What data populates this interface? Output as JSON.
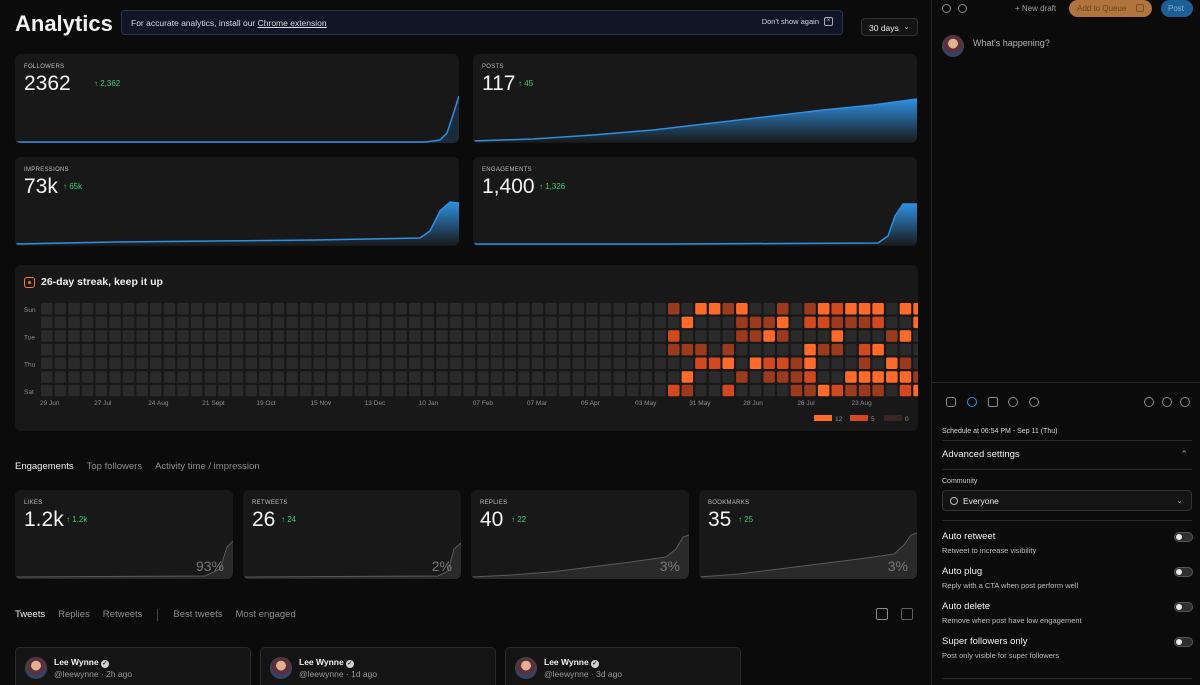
{
  "header": {
    "title": "Analytics",
    "banner_text": "For accurate analytics, install our",
    "banner_link": "Chrome extension",
    "banner_dismiss": "Don't show again",
    "range": "30 days"
  },
  "stats": [
    {
      "label": "FOLLOWERS",
      "value": "2362",
      "delta": "↑ 2,362"
    },
    {
      "label": "POSTS",
      "value": "117",
      "delta": "↑ 45"
    },
    {
      "label": "IMPRESSIONS",
      "value": "73k",
      "delta": "↑ 65k"
    },
    {
      "label": "ENGAGEMENTS",
      "value": "1,400",
      "delta": "↑ 1,326"
    }
  ],
  "streak": {
    "title": "26-day streak, keep it up",
    "day_labels": [
      "Sun",
      "Tue",
      "Thu",
      "Sat"
    ],
    "month_labels": [
      "29 Jun",
      "27 Jul",
      "24 Aug",
      "21 Sept",
      "19 Oct",
      "15 Nov",
      "13 Dec",
      "10 Jan",
      "07 Feb",
      "07 Mar",
      "05 Apr",
      "03 May",
      "31 May",
      "28 Jun",
      "26 Jul",
      "23 Aug"
    ],
    "legend": [
      "12",
      "5",
      "0"
    ],
    "colors": {
      "empty": "#2a2a2a",
      "low": "#9c3a1d",
      "mid": "#d2491f",
      "high": "#ff6a2b"
    }
  },
  "engagement_tabs": [
    "Engagements",
    "Top followers",
    "Activity time / impression"
  ],
  "engagements": [
    {
      "label": "LIKES",
      "value": "1.2k",
      "delta": "↑ 1.2k",
      "pct": "93%"
    },
    {
      "label": "RETWEETS",
      "value": "26",
      "delta": "↑ 24",
      "pct": "2%"
    },
    {
      "label": "REPLIES",
      "value": "40",
      "delta": "↑ 22",
      "pct": "3%"
    },
    {
      "label": "BOOKMARKS",
      "value": "35",
      "delta": "↑ 25",
      "pct": "3%"
    }
  ],
  "tweet_tabs": [
    "Tweets",
    "Replies",
    "Retweets",
    "Best tweets",
    "Most engaged"
  ],
  "tweets": [
    {
      "name": "Lee Wynne",
      "handle": "@leewynne",
      "time": "2h ago"
    },
    {
      "name": "Lee Wynne",
      "handle": "@leewynne",
      "time": "1d ago"
    },
    {
      "name": "Lee Wynne",
      "handle": "@leewynne",
      "time": "3d ago"
    }
  ],
  "composer": {
    "new_draft": "+ New draft",
    "add_to_queue": "Add to Queue",
    "post": "Post",
    "placeholder": "What's happening?",
    "schedule": "Schedule at 06:54 PM - Sep 11 (Thu)",
    "advanced": "Advanced settings",
    "community_label": "Community",
    "community_value": "Everyone",
    "options": [
      {
        "title": "Auto retweet",
        "desc": "Retweet to increase visibility"
      },
      {
        "title": "Auto plug",
        "desc": "Reply with a CTA when post perform well"
      },
      {
        "title": "Auto delete",
        "desc": "Remove when post have low engagement"
      },
      {
        "title": "Super followers only",
        "desc": "Post only visible for super followers"
      }
    ]
  },
  "accent": "#2f8fe0",
  "positive": "#3ec97b"
}
